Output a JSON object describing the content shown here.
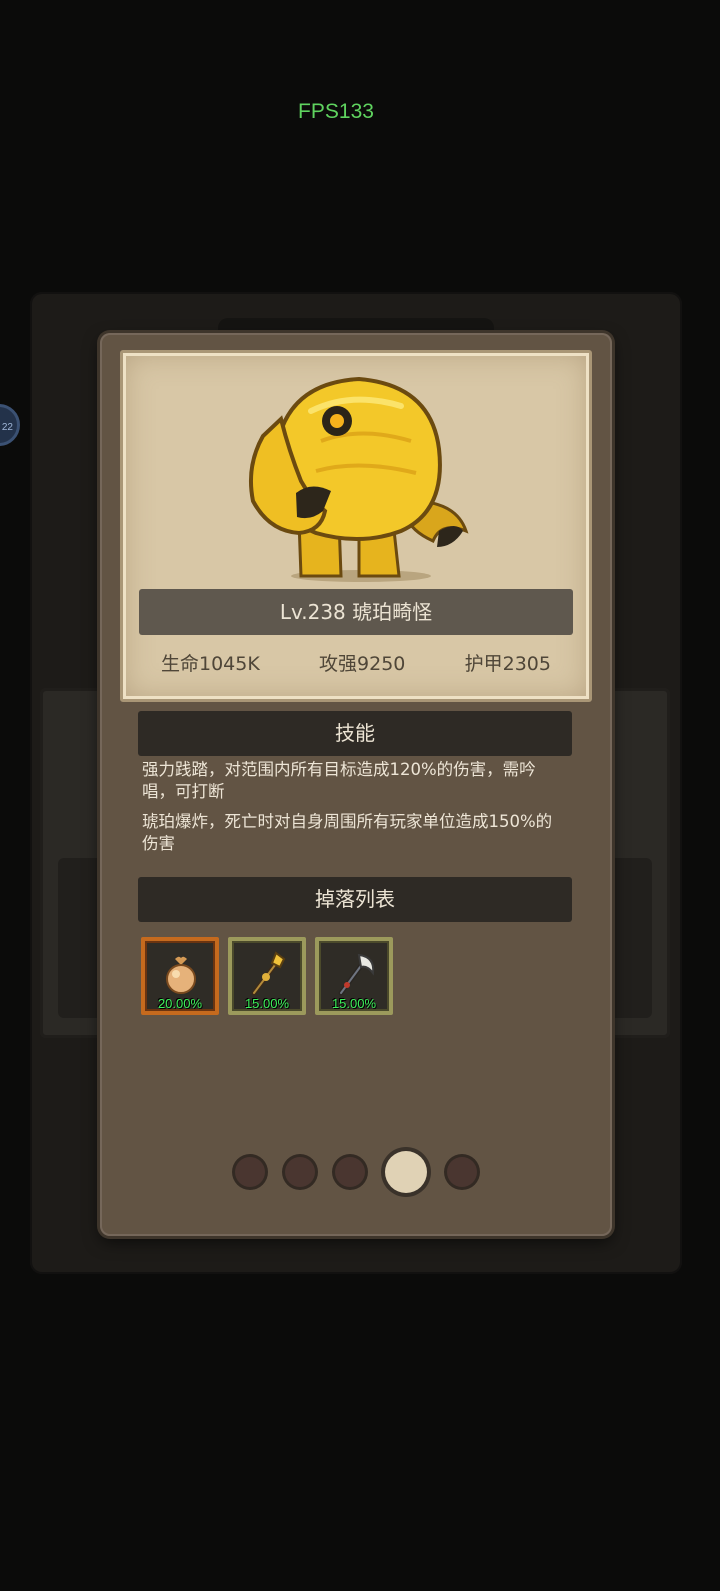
{
  "fps": "FPS133",
  "side_badge": "22",
  "monster": {
    "name": "Lv.238 琥珀畸怪",
    "stats": [
      "生命1045K",
      "攻强9250",
      "护甲2305"
    ]
  },
  "skills": {
    "title": "技能",
    "items": [
      "强力践踏，对范围内所有目标造成120%的伤害，需吟唱，可打断",
      "琥珀爆炸，死亡时对自身周围所有玩家单位造成150%的伤害"
    ]
  },
  "drops": {
    "title": "掉落列表",
    "items": [
      {
        "icon": "pouch-icon",
        "rate": "20.00%",
        "frame_color": "#c56a1e"
      },
      {
        "icon": "scepter-icon",
        "rate": "15.00%",
        "frame_color": "#9c9a5c"
      },
      {
        "icon": "axe-icon",
        "rate": "15.00%",
        "frame_color": "#9c9a5c"
      }
    ]
  },
  "pager": {
    "total": 5,
    "active_index": 3
  }
}
